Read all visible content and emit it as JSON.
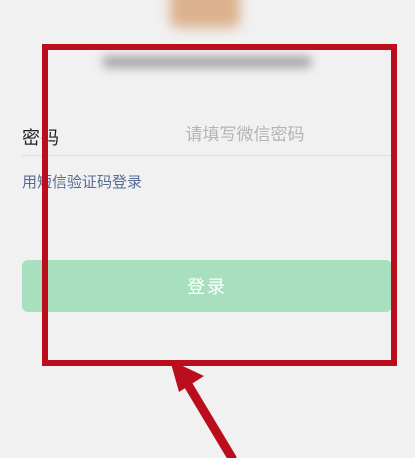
{
  "login": {
    "password_label": "密码",
    "password_placeholder": "请填写微信密码",
    "sms_login_link": "用短信验证码登录",
    "login_button": "登录"
  },
  "colors": {
    "accent_link": "#586b95",
    "login_button_disabled": "#a8e0bf",
    "annotation": "#bb0e1c"
  },
  "icons": {
    "annotation_arrow": "arrow-up-left-icon"
  }
}
